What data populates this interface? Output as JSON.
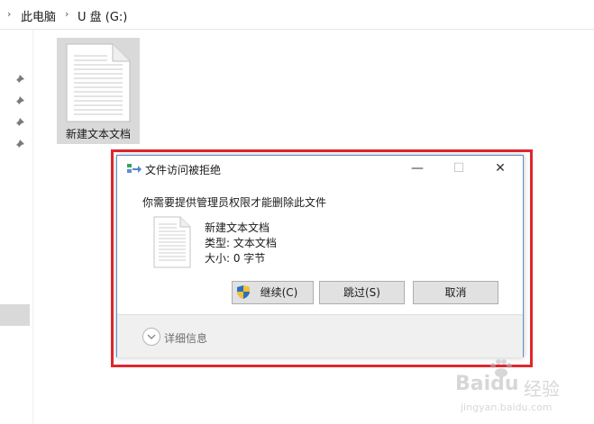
{
  "breadcrumb": {
    "items": [
      "此电脑",
      "U 盘 (G:)"
    ]
  },
  "desktop": {
    "file_name": "新建文本文档"
  },
  "dialog": {
    "title": "文件访问被拒绝",
    "message": "你需要提供管理员权限才能删除此文件",
    "file_name": "新建文本文档",
    "file_type": "类型: 文本文档",
    "file_size": "大小: 0 字节",
    "buttons": {
      "continue": "继续(C)",
      "skip": "跳过(S)",
      "cancel": "取消"
    },
    "details_label": "详细信息"
  },
  "watermark": {
    "brand": "Baidu",
    "product": "经验",
    "url": "jingyan.baidu.com"
  },
  "colors": {
    "highlight_frame": "#e0262d",
    "dialog_border": "#5a8fc8",
    "selected_bg": "#d9d9d9"
  }
}
